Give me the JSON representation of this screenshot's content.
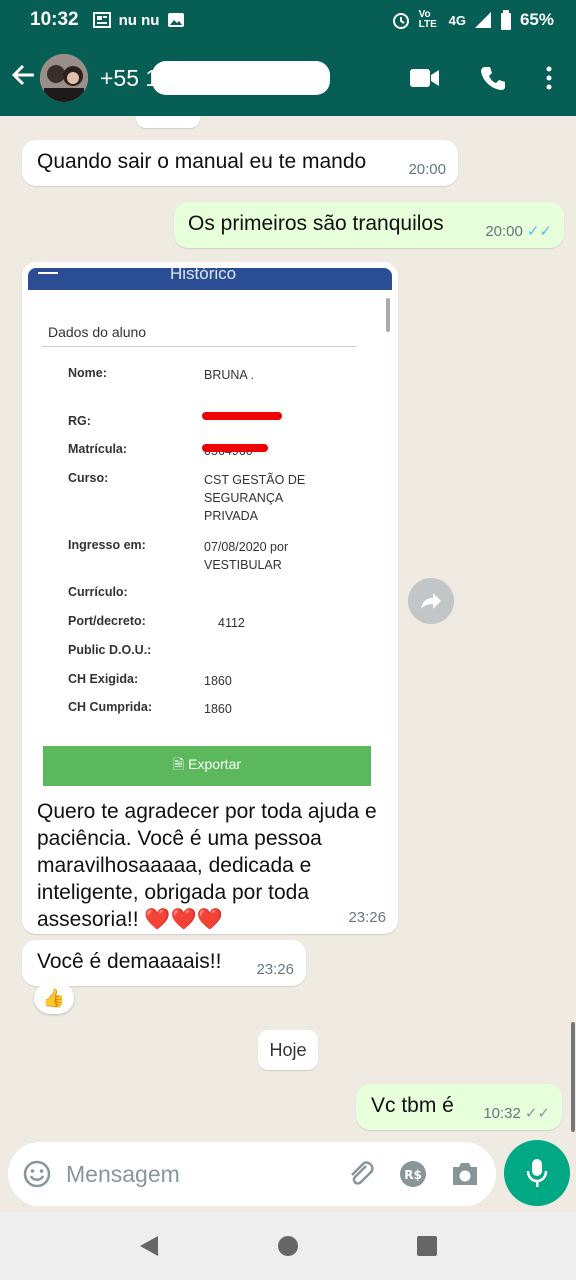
{
  "status_bar": {
    "time": "10:32",
    "carrier_icons": "nu nu",
    "network": "4G",
    "volte": "Vo LTE",
    "battery": "65%"
  },
  "header": {
    "contact_name": "+55 11",
    "redacted": true
  },
  "messages": [
    {
      "text": "Quando sair o manual eu te mando",
      "time": "20:00",
      "direction": "in"
    },
    {
      "text": "Os primeiros são tranquilos",
      "time": "20:00",
      "direction": "out",
      "status": "read"
    },
    {
      "direction": "in",
      "image": {
        "header_title": "Histórico",
        "section_title": "Dados do aluno",
        "fields": [
          {
            "label": "Nome:",
            "value": "BRUNA ."
          },
          {
            "label": "RG:",
            "value": ""
          },
          {
            "label": "Matrícula:",
            "value": "0564960"
          },
          {
            "label": "Curso:",
            "value": "CST GESTÃO DE SEGURANÇA PRIVADA"
          },
          {
            "label": "Ingresso em:",
            "value": "07/08/2020 por VESTIBULAR"
          },
          {
            "label": "Currículo:",
            "value": ""
          },
          {
            "label": "Port/decreto:",
            "value": "4112"
          },
          {
            "label": "Public D.O.U.:",
            "value": ""
          },
          {
            "label": "CH Exigida:",
            "value": "1860"
          },
          {
            "label": "CH Cumprida:",
            "value": "1860"
          }
        ],
        "export_label": "Exportar"
      },
      "text": "Quero te agradecer por toda ajuda e paciência. Você é uma pessoa maravilhosaaaaa, dedicada e inteligente, obrigada por toda assesoria!! ❤️❤️❤️",
      "time": "23:26"
    },
    {
      "text": "Você é demaaaais!!",
      "time": "23:26",
      "direction": "in",
      "reaction": "👍"
    },
    {
      "text": "Vc tbm é",
      "time": "10:32",
      "direction": "out",
      "status": "delivered"
    }
  ],
  "date_separator": "Hoje",
  "composer": {
    "placeholder": "Mensagem"
  }
}
